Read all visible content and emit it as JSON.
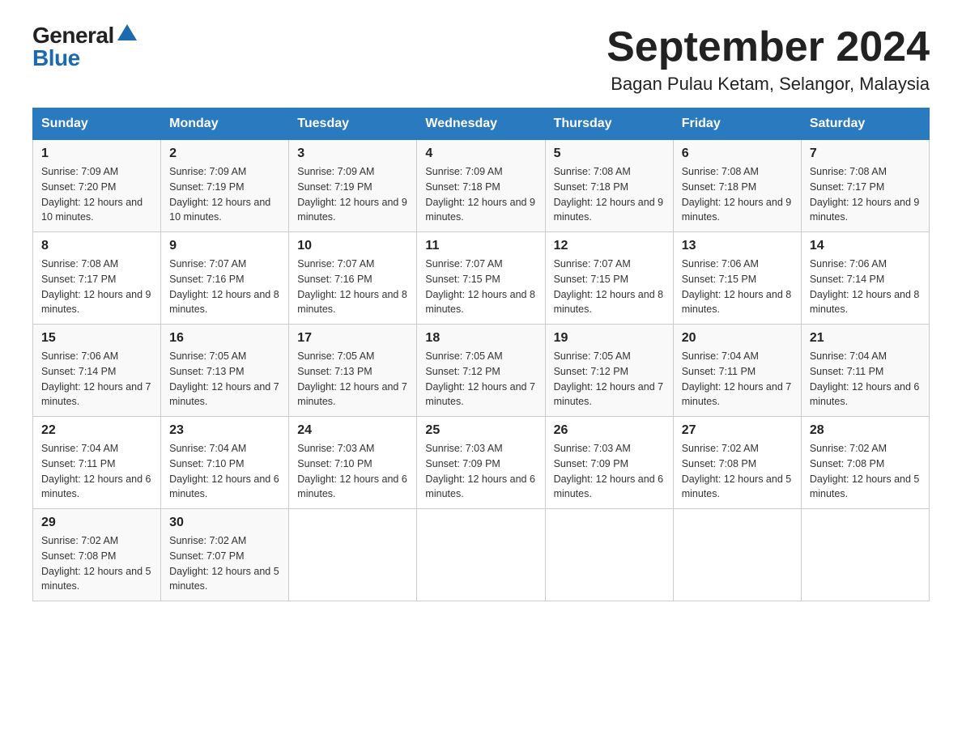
{
  "logo": {
    "general": "General",
    "blue": "Blue"
  },
  "title": "September 2024",
  "subtitle": "Bagan Pulau Ketam, Selangor, Malaysia",
  "days_header": [
    "Sunday",
    "Monday",
    "Tuesday",
    "Wednesday",
    "Thursday",
    "Friday",
    "Saturday"
  ],
  "weeks": [
    [
      {
        "day": "1",
        "sunrise": "7:09 AM",
        "sunset": "7:20 PM",
        "daylight": "12 hours and 10 minutes."
      },
      {
        "day": "2",
        "sunrise": "7:09 AM",
        "sunset": "7:19 PM",
        "daylight": "12 hours and 10 minutes."
      },
      {
        "day": "3",
        "sunrise": "7:09 AM",
        "sunset": "7:19 PM",
        "daylight": "12 hours and 9 minutes."
      },
      {
        "day": "4",
        "sunrise": "7:09 AM",
        "sunset": "7:18 PM",
        "daylight": "12 hours and 9 minutes."
      },
      {
        "day": "5",
        "sunrise": "7:08 AM",
        "sunset": "7:18 PM",
        "daylight": "12 hours and 9 minutes."
      },
      {
        "day": "6",
        "sunrise": "7:08 AM",
        "sunset": "7:18 PM",
        "daylight": "12 hours and 9 minutes."
      },
      {
        "day": "7",
        "sunrise": "7:08 AM",
        "sunset": "7:17 PM",
        "daylight": "12 hours and 9 minutes."
      }
    ],
    [
      {
        "day": "8",
        "sunrise": "7:08 AM",
        "sunset": "7:17 PM",
        "daylight": "12 hours and 9 minutes."
      },
      {
        "day": "9",
        "sunrise": "7:07 AM",
        "sunset": "7:16 PM",
        "daylight": "12 hours and 8 minutes."
      },
      {
        "day": "10",
        "sunrise": "7:07 AM",
        "sunset": "7:16 PM",
        "daylight": "12 hours and 8 minutes."
      },
      {
        "day": "11",
        "sunrise": "7:07 AM",
        "sunset": "7:15 PM",
        "daylight": "12 hours and 8 minutes."
      },
      {
        "day": "12",
        "sunrise": "7:07 AM",
        "sunset": "7:15 PM",
        "daylight": "12 hours and 8 minutes."
      },
      {
        "day": "13",
        "sunrise": "7:06 AM",
        "sunset": "7:15 PM",
        "daylight": "12 hours and 8 minutes."
      },
      {
        "day": "14",
        "sunrise": "7:06 AM",
        "sunset": "7:14 PM",
        "daylight": "12 hours and 8 minutes."
      }
    ],
    [
      {
        "day": "15",
        "sunrise": "7:06 AM",
        "sunset": "7:14 PM",
        "daylight": "12 hours and 7 minutes."
      },
      {
        "day": "16",
        "sunrise": "7:05 AM",
        "sunset": "7:13 PM",
        "daylight": "12 hours and 7 minutes."
      },
      {
        "day": "17",
        "sunrise": "7:05 AM",
        "sunset": "7:13 PM",
        "daylight": "12 hours and 7 minutes."
      },
      {
        "day": "18",
        "sunrise": "7:05 AM",
        "sunset": "7:12 PM",
        "daylight": "12 hours and 7 minutes."
      },
      {
        "day": "19",
        "sunrise": "7:05 AM",
        "sunset": "7:12 PM",
        "daylight": "12 hours and 7 minutes."
      },
      {
        "day": "20",
        "sunrise": "7:04 AM",
        "sunset": "7:11 PM",
        "daylight": "12 hours and 7 minutes."
      },
      {
        "day": "21",
        "sunrise": "7:04 AM",
        "sunset": "7:11 PM",
        "daylight": "12 hours and 6 minutes."
      }
    ],
    [
      {
        "day": "22",
        "sunrise": "7:04 AM",
        "sunset": "7:11 PM",
        "daylight": "12 hours and 6 minutes."
      },
      {
        "day": "23",
        "sunrise": "7:04 AM",
        "sunset": "7:10 PM",
        "daylight": "12 hours and 6 minutes."
      },
      {
        "day": "24",
        "sunrise": "7:03 AM",
        "sunset": "7:10 PM",
        "daylight": "12 hours and 6 minutes."
      },
      {
        "day": "25",
        "sunrise": "7:03 AM",
        "sunset": "7:09 PM",
        "daylight": "12 hours and 6 minutes."
      },
      {
        "day": "26",
        "sunrise": "7:03 AM",
        "sunset": "7:09 PM",
        "daylight": "12 hours and 6 minutes."
      },
      {
        "day": "27",
        "sunrise": "7:02 AM",
        "sunset": "7:08 PM",
        "daylight": "12 hours and 5 minutes."
      },
      {
        "day": "28",
        "sunrise": "7:02 AM",
        "sunset": "7:08 PM",
        "daylight": "12 hours and 5 minutes."
      }
    ],
    [
      {
        "day": "29",
        "sunrise": "7:02 AM",
        "sunset": "7:08 PM",
        "daylight": "12 hours and 5 minutes."
      },
      {
        "day": "30",
        "sunrise": "7:02 AM",
        "sunset": "7:07 PM",
        "daylight": "12 hours and 5 minutes."
      },
      null,
      null,
      null,
      null,
      null
    ]
  ]
}
